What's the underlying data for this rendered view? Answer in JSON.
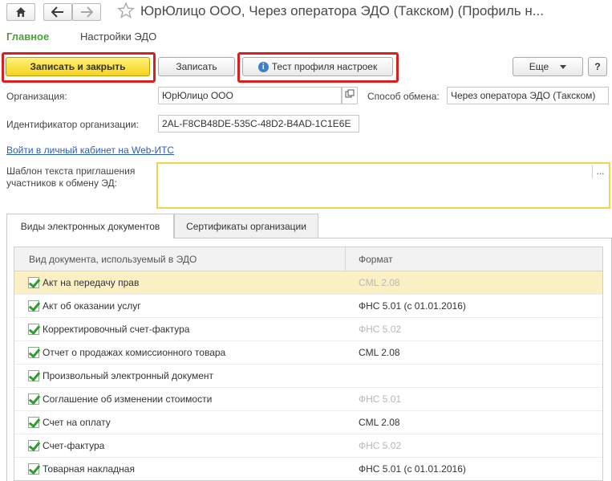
{
  "window": {
    "title": "ЮрЮлицо ООО, Через оператора ЭДО (Такском) (Профиль н..."
  },
  "menu": {
    "main": "Главное",
    "settings": "Настройки ЭДО"
  },
  "toolbar": {
    "save_close": "Записать и закрыть",
    "save": "Записать",
    "test_profile": "Тест профиля настроек",
    "more": "Еще",
    "help": "?"
  },
  "form": {
    "org_label": "Организация:",
    "org_value": "ЮрЮлицо ООО",
    "exchange_label": "Способ обмена:",
    "exchange_value": "Через оператора ЭДО (Такском)",
    "id_label": "Идентификатор организации:",
    "id_value": "2AL-F8CB48DE-535C-48D2-B4AD-1C1E6E",
    "cabinet_link": "Войти в личный кабинет на Web-ИТС",
    "template_label_line1": "Шаблон текста приглашения",
    "template_label_line2": "участников к обмену ЭД:",
    "template_value": "",
    "ellipsis": "..."
  },
  "tabs": [
    {
      "label": "Виды электронных документов"
    },
    {
      "label": "Сертификаты организации"
    }
  ],
  "table": {
    "headers": [
      "Вид документа, используемый в ЭДО",
      "Формат"
    ],
    "rows": [
      {
        "name": "Акт на передачу прав",
        "format": "CML 2.08",
        "checked": true,
        "format_muted": true,
        "selected": true
      },
      {
        "name": "Акт об оказании услуг",
        "format": "ФНС 5.01 (с 01.01.2016)",
        "checked": true,
        "format_muted": false,
        "selected": false
      },
      {
        "name": "Корректировочный счет-фактура",
        "format": "ФНС 5.02",
        "checked": true,
        "format_muted": true,
        "selected": false
      },
      {
        "name": "Отчет о продажах комиссионного товара",
        "format": "CML 2.08",
        "checked": true,
        "format_muted": false,
        "selected": false
      },
      {
        "name": "Произвольный электронный документ",
        "format": "",
        "checked": true,
        "format_muted": false,
        "selected": false
      },
      {
        "name": "Соглашение об изменении стоимости",
        "format": "ФНС 5.01",
        "checked": true,
        "format_muted": true,
        "selected": false
      },
      {
        "name": "Счет на оплату",
        "format": "CML 2.08",
        "checked": true,
        "format_muted": false,
        "selected": false
      },
      {
        "name": "Счет-фактура",
        "format": "ФНС 5.02",
        "checked": true,
        "format_muted": true,
        "selected": false
      },
      {
        "name": "Товарная накладная",
        "format": "ФНС 5.01 (с 01.01.2016)",
        "checked": true,
        "format_muted": false,
        "selected": false
      }
    ]
  },
  "colors": {
    "accent_green": "#4aa13a",
    "highlight_red": "#d91f1f",
    "primary_yellow": "#f5d31e",
    "selected_row": "#fbf0c4"
  }
}
